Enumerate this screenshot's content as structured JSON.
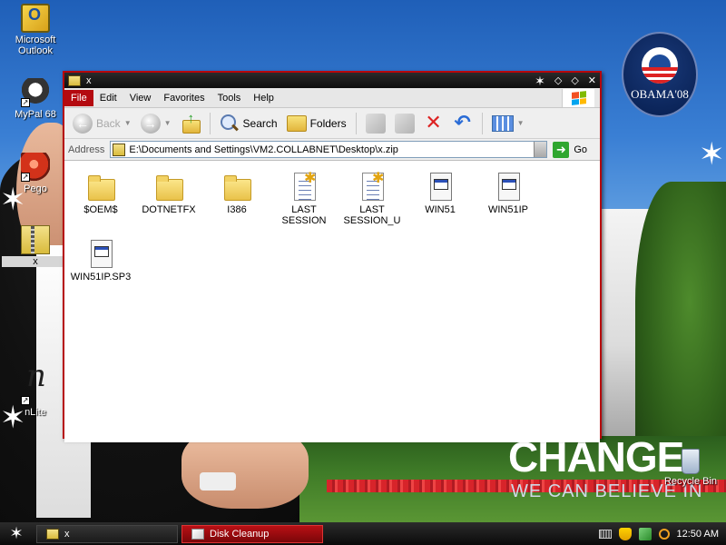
{
  "desktop": {
    "icons": [
      {
        "label": "Microsoft Outlook",
        "icon": "outlook-icon"
      },
      {
        "label": "MyPal 68",
        "icon": "mypal-icon"
      },
      {
        "label": "Pego",
        "icon": "pego-icon"
      },
      {
        "label": "x",
        "icon": "zip-folder-icon"
      },
      {
        "label": "nLite",
        "icon": "nlite-icon"
      },
      {
        "label": "Recycle Bin",
        "icon": "recycle-bin-icon"
      }
    ],
    "wallpaper": {
      "slogan": "CHANGE",
      "sub_slogan": "WE CAN BELIEVE IN",
      "logo_text": "OBAMA'08"
    }
  },
  "window": {
    "title": "x",
    "menu": [
      "File",
      "Edit",
      "View",
      "Favorites",
      "Tools",
      "Help"
    ],
    "active_menu": "File",
    "toolbar": {
      "back_label": "Back",
      "search_label": "Search",
      "folders_label": "Folders"
    },
    "address": {
      "label": "Address",
      "value": "E:\\Documents and Settings\\VM2.COLLABNET\\Desktop\\x.zip",
      "go_label": "Go"
    },
    "files": [
      {
        "name": "$OEM$",
        "type": "folder"
      },
      {
        "name": "DOTNETFX",
        "type": "folder"
      },
      {
        "name": "I386",
        "type": "folder"
      },
      {
        "name": "LAST SESSION",
        "type": "settings-file"
      },
      {
        "name": "LAST SESSION_U",
        "type": "settings-file"
      },
      {
        "name": "WIN51",
        "type": "system-file"
      },
      {
        "name": "WIN51IP",
        "type": "system-file"
      },
      {
        "name": "WIN51IP.SP3",
        "type": "system-file"
      }
    ]
  },
  "taskbar": {
    "tasks": [
      {
        "label": "x",
        "active": false
      },
      {
        "label": "Disk Cleanup",
        "active": true
      }
    ],
    "clock": "12:50 AM"
  },
  "colors": {
    "window_border": "#b6070c",
    "menu_active": "#b40a10",
    "taskbar": "#1a1a1a"
  }
}
